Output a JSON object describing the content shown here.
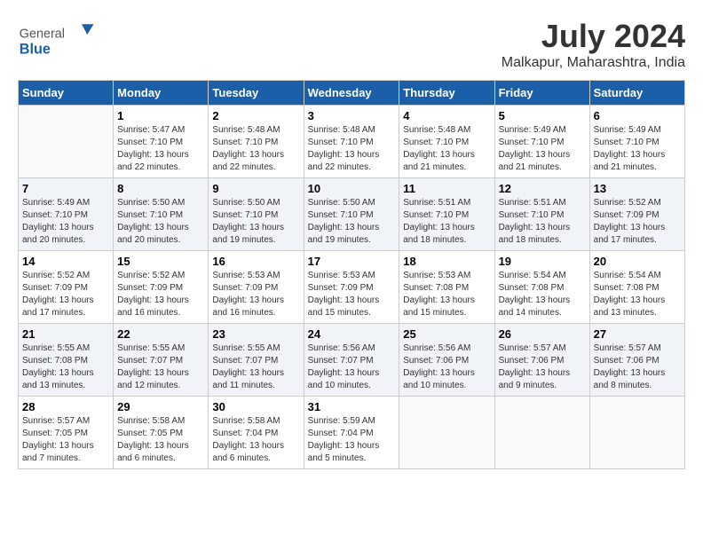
{
  "header": {
    "logo_general": "General",
    "logo_blue": "Blue",
    "month_year": "July 2024",
    "location": "Malkapur, Maharashtra, India"
  },
  "days": [
    "Sunday",
    "Monday",
    "Tuesday",
    "Wednesday",
    "Thursday",
    "Friday",
    "Saturday"
  ],
  "weeks": [
    [
      {
        "date": "",
        "info": ""
      },
      {
        "date": "1",
        "info": "Sunrise: 5:47 AM\nSunset: 7:10 PM\nDaylight: 13 hours\nand 22 minutes."
      },
      {
        "date": "2",
        "info": "Sunrise: 5:48 AM\nSunset: 7:10 PM\nDaylight: 13 hours\nand 22 minutes."
      },
      {
        "date": "3",
        "info": "Sunrise: 5:48 AM\nSunset: 7:10 PM\nDaylight: 13 hours\nand 22 minutes."
      },
      {
        "date": "4",
        "info": "Sunrise: 5:48 AM\nSunset: 7:10 PM\nDaylight: 13 hours\nand 21 minutes."
      },
      {
        "date": "5",
        "info": "Sunrise: 5:49 AM\nSunset: 7:10 PM\nDaylight: 13 hours\nand 21 minutes."
      },
      {
        "date": "6",
        "info": "Sunrise: 5:49 AM\nSunset: 7:10 PM\nDaylight: 13 hours\nand 21 minutes."
      }
    ],
    [
      {
        "date": "7",
        "info": "Sunrise: 5:49 AM\nSunset: 7:10 PM\nDaylight: 13 hours\nand 20 minutes."
      },
      {
        "date": "8",
        "info": "Sunrise: 5:50 AM\nSunset: 7:10 PM\nDaylight: 13 hours\nand 20 minutes."
      },
      {
        "date": "9",
        "info": "Sunrise: 5:50 AM\nSunset: 7:10 PM\nDaylight: 13 hours\nand 19 minutes."
      },
      {
        "date": "10",
        "info": "Sunrise: 5:50 AM\nSunset: 7:10 PM\nDaylight: 13 hours\nand 19 minutes."
      },
      {
        "date": "11",
        "info": "Sunrise: 5:51 AM\nSunset: 7:10 PM\nDaylight: 13 hours\nand 18 minutes."
      },
      {
        "date": "12",
        "info": "Sunrise: 5:51 AM\nSunset: 7:10 PM\nDaylight: 13 hours\nand 18 minutes."
      },
      {
        "date": "13",
        "info": "Sunrise: 5:52 AM\nSunset: 7:09 PM\nDaylight: 13 hours\nand 17 minutes."
      }
    ],
    [
      {
        "date": "14",
        "info": "Sunrise: 5:52 AM\nSunset: 7:09 PM\nDaylight: 13 hours\nand 17 minutes."
      },
      {
        "date": "15",
        "info": "Sunrise: 5:52 AM\nSunset: 7:09 PM\nDaylight: 13 hours\nand 16 minutes."
      },
      {
        "date": "16",
        "info": "Sunrise: 5:53 AM\nSunset: 7:09 PM\nDaylight: 13 hours\nand 16 minutes."
      },
      {
        "date": "17",
        "info": "Sunrise: 5:53 AM\nSunset: 7:09 PM\nDaylight: 13 hours\nand 15 minutes."
      },
      {
        "date": "18",
        "info": "Sunrise: 5:53 AM\nSunset: 7:08 PM\nDaylight: 13 hours\nand 15 minutes."
      },
      {
        "date": "19",
        "info": "Sunrise: 5:54 AM\nSunset: 7:08 PM\nDaylight: 13 hours\nand 14 minutes."
      },
      {
        "date": "20",
        "info": "Sunrise: 5:54 AM\nSunset: 7:08 PM\nDaylight: 13 hours\nand 13 minutes."
      }
    ],
    [
      {
        "date": "21",
        "info": "Sunrise: 5:55 AM\nSunset: 7:08 PM\nDaylight: 13 hours\nand 13 minutes."
      },
      {
        "date": "22",
        "info": "Sunrise: 5:55 AM\nSunset: 7:07 PM\nDaylight: 13 hours\nand 12 minutes."
      },
      {
        "date": "23",
        "info": "Sunrise: 5:55 AM\nSunset: 7:07 PM\nDaylight: 13 hours\nand 11 minutes."
      },
      {
        "date": "24",
        "info": "Sunrise: 5:56 AM\nSunset: 7:07 PM\nDaylight: 13 hours\nand 10 minutes."
      },
      {
        "date": "25",
        "info": "Sunrise: 5:56 AM\nSunset: 7:06 PM\nDaylight: 13 hours\nand 10 minutes."
      },
      {
        "date": "26",
        "info": "Sunrise: 5:57 AM\nSunset: 7:06 PM\nDaylight: 13 hours\nand 9 minutes."
      },
      {
        "date": "27",
        "info": "Sunrise: 5:57 AM\nSunset: 7:06 PM\nDaylight: 13 hours\nand 8 minutes."
      }
    ],
    [
      {
        "date": "28",
        "info": "Sunrise: 5:57 AM\nSunset: 7:05 PM\nDaylight: 13 hours\nand 7 minutes."
      },
      {
        "date": "29",
        "info": "Sunrise: 5:58 AM\nSunset: 7:05 PM\nDaylight: 13 hours\nand 6 minutes."
      },
      {
        "date": "30",
        "info": "Sunrise: 5:58 AM\nSunset: 7:04 PM\nDaylight: 13 hours\nand 6 minutes."
      },
      {
        "date": "31",
        "info": "Sunrise: 5:59 AM\nSunset: 7:04 PM\nDaylight: 13 hours\nand 5 minutes."
      },
      {
        "date": "",
        "info": ""
      },
      {
        "date": "",
        "info": ""
      },
      {
        "date": "",
        "info": ""
      }
    ]
  ]
}
